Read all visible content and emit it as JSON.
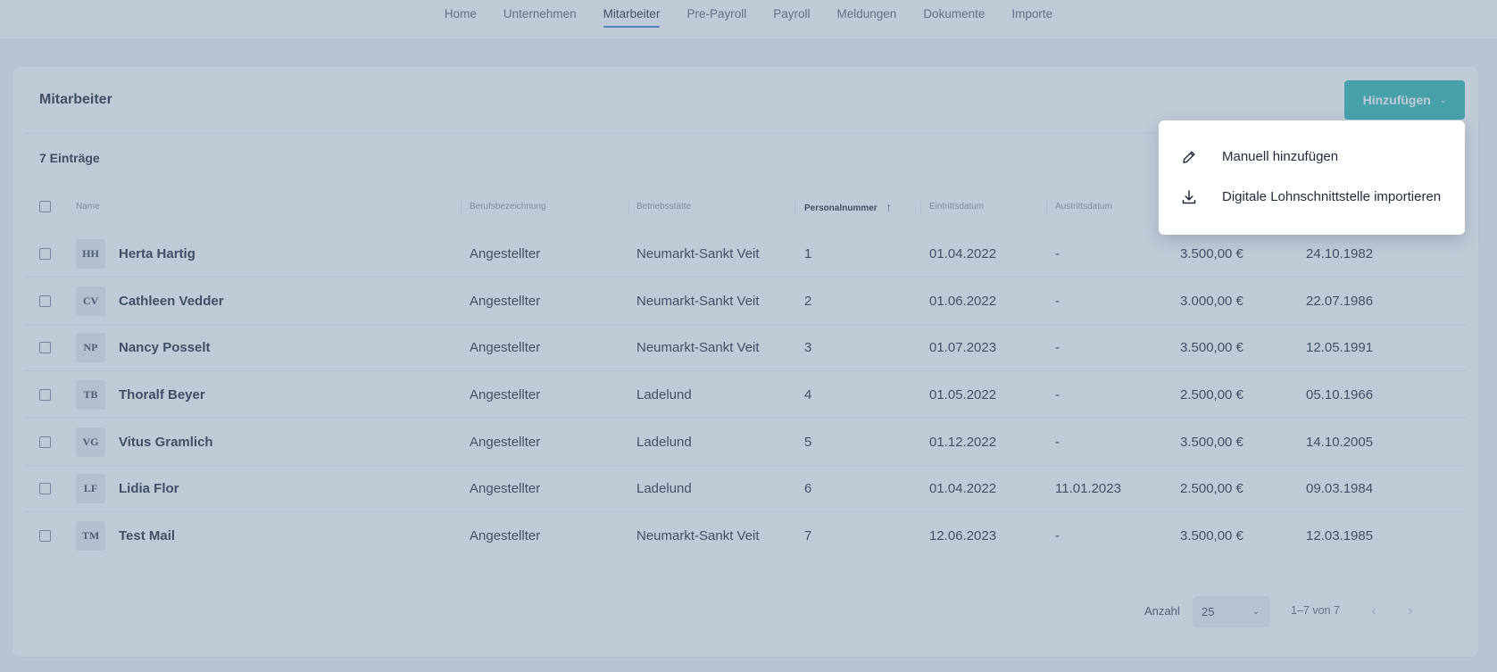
{
  "nav": {
    "items": [
      {
        "label": "Home",
        "active": false
      },
      {
        "label": "Unternehmen",
        "active": false
      },
      {
        "label": "Mitarbeiter",
        "active": true
      },
      {
        "label": "Pre-Payroll",
        "active": false
      },
      {
        "label": "Payroll",
        "active": false
      },
      {
        "label": "Meldungen",
        "active": false
      },
      {
        "label": "Dokumente",
        "active": false
      },
      {
        "label": "Importe",
        "active": false
      }
    ]
  },
  "card": {
    "title": "Mitarbeiter",
    "add_button_label": "Hinzufügen",
    "entry_count": "7 Einträge"
  },
  "table": {
    "columns": {
      "name": "Name",
      "job": "Berufsbezeichnung",
      "site": "Betriebsstätte",
      "number": "Personalnummer",
      "entry": "Eintrittsdatum",
      "exit": "Austrittsdatum"
    },
    "sort": {
      "column": "Personalnummer",
      "direction": "ascending"
    },
    "rows": [
      {
        "initials": "HH",
        "name": "Herta Hartig",
        "job": "Angestellter",
        "site": "Neumarkt-Sankt Veit",
        "number": "1",
        "entry": "01.04.2022",
        "exit": "-",
        "salary": "3.500,00 €",
        "birth": "24.10.1982"
      },
      {
        "initials": "CV",
        "name": "Cathleen Vedder",
        "job": "Angestellter",
        "site": "Neumarkt-Sankt Veit",
        "number": "2",
        "entry": "01.06.2022",
        "exit": "-",
        "salary": "3.000,00 €",
        "birth": "22.07.1986"
      },
      {
        "initials": "NP",
        "name": "Nancy Posselt",
        "job": "Angestellter",
        "site": "Neumarkt-Sankt Veit",
        "number": "3",
        "entry": "01.07.2023",
        "exit": "-",
        "salary": "3.500,00 €",
        "birth": "12.05.1991"
      },
      {
        "initials": "TB",
        "name": "Thoralf Beyer",
        "job": "Angestellter",
        "site": "Ladelund",
        "number": "4",
        "entry": "01.05.2022",
        "exit": "-",
        "salary": "2.500,00 €",
        "birth": "05.10.1966"
      },
      {
        "initials": "VG",
        "name": "Vitus Gramlich",
        "job": "Angestellter",
        "site": "Ladelund",
        "number": "5",
        "entry": "01.12.2022",
        "exit": "-",
        "salary": "3.500,00 €",
        "birth": "14.10.2005"
      },
      {
        "initials": "LF",
        "name": "Lidia Flor",
        "job": "Angestellter",
        "site": "Ladelund",
        "number": "6",
        "entry": "01.04.2022",
        "exit": "11.01.2023",
        "salary": "2.500,00 €",
        "birth": "09.03.1984"
      },
      {
        "initials": "TM",
        "name": "Test Mail",
        "job": "Angestellter",
        "site": "Neumarkt-Sankt Veit",
        "number": "7",
        "entry": "12.06.2023",
        "exit": "-",
        "salary": "3.500,00 €",
        "birth": "12.03.1985"
      }
    ]
  },
  "pagination": {
    "page_size_label": "Anzahl",
    "page_size": "25",
    "range": "1–7 von 7"
  },
  "dropdown": {
    "items": [
      {
        "label": "Manuell hinzufügen",
        "icon": "pencil-icon"
      },
      {
        "label": "Digitale Lohnschnittstelle importieren",
        "icon": "download-icon"
      }
    ]
  },
  "colors": {
    "accent": "#2fb9b3",
    "nav_active": "#4a7fd6",
    "overlay": "#6980a0"
  }
}
